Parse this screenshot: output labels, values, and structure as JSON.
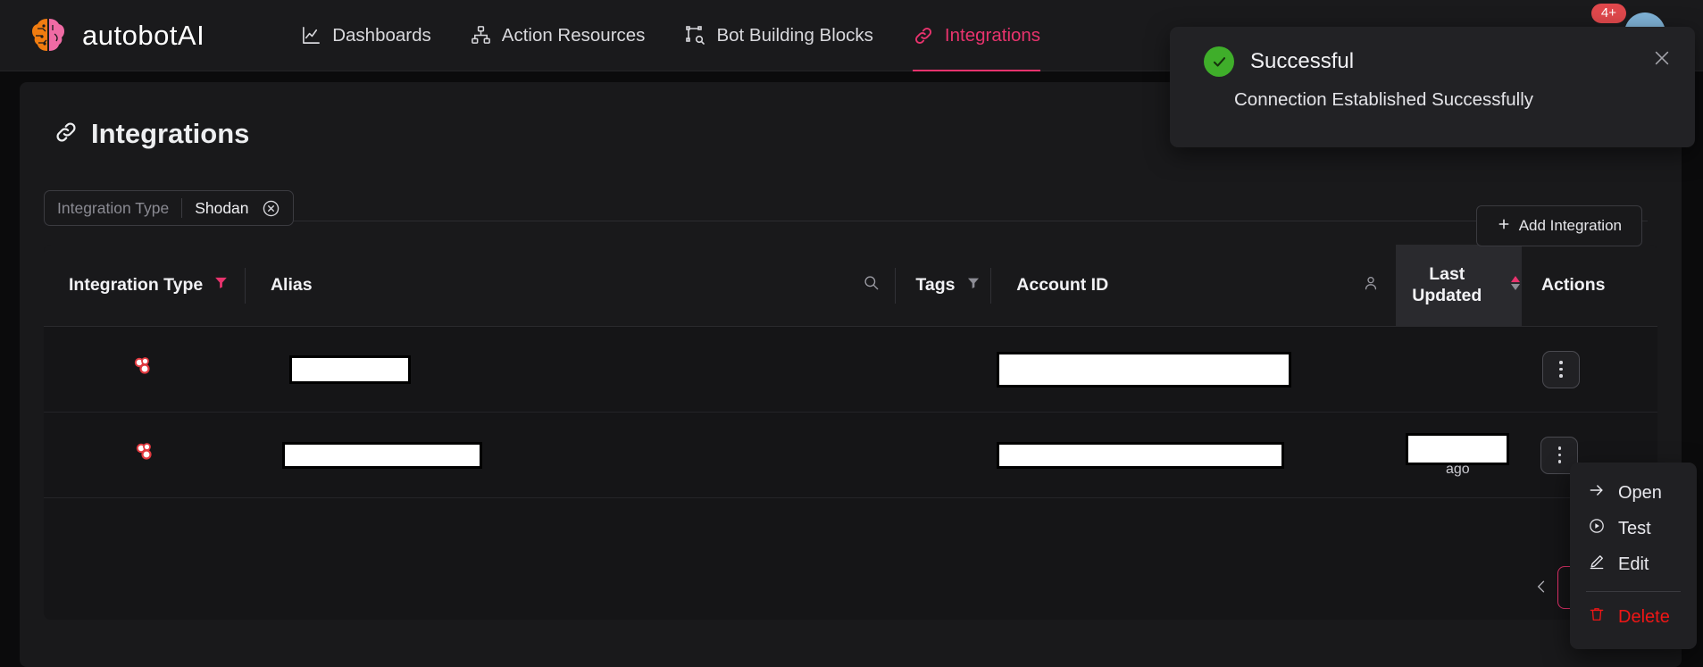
{
  "nav": {
    "brand": "autobotAI",
    "items": [
      {
        "label": "Dashboards",
        "icon": "chart-line-icon",
        "active": false
      },
      {
        "label": "Action Resources",
        "icon": "sitemap-icon",
        "active": false
      },
      {
        "label": "Bot Building Blocks",
        "icon": "blocks-icon",
        "active": false
      },
      {
        "label": "Integrations",
        "icon": "link-chain-icon",
        "active": true
      }
    ],
    "badge_count": "4+",
    "avatar": "user-avatar"
  },
  "page": {
    "title": "Integrations",
    "title_icon": "link-chain-icon",
    "add_button_label": "Add Integration"
  },
  "filter": {
    "label": "Integration Type",
    "value": "Shodan",
    "clear_icon": "circle-x-icon"
  },
  "table": {
    "columns": [
      {
        "key": "type",
        "label": "Integration Type",
        "icon": "filter-icon-active"
      },
      {
        "key": "alias",
        "label": "Alias",
        "icon": ""
      },
      {
        "key": "search",
        "label": "",
        "icon": "search-icon"
      },
      {
        "key": "tags",
        "label": "Tags",
        "icon": "filter-icon"
      },
      {
        "key": "account",
        "label": "Account ID",
        "icon": ""
      },
      {
        "key": "person",
        "label": "",
        "icon": "person-icon"
      },
      {
        "key": "last_updated",
        "label": "Last Updated",
        "icon": "sort-asc-desc-icon"
      },
      {
        "key": "actions",
        "label": "Actions",
        "icon": ""
      }
    ],
    "rows": [
      {
        "type_icon": "shodan-logo",
        "alias": "",
        "alias_redacted": true,
        "tags": "",
        "account": "",
        "account_redacted": true,
        "last_updated": "",
        "last_updated_redacted": false,
        "actions_icon": "kebab-menu-icon"
      },
      {
        "type_icon": "shodan-logo",
        "alias": "",
        "alias_redacted": true,
        "tags": "",
        "account": "",
        "account_redacted": true,
        "last_updated": "ago",
        "last_updated_redacted": true,
        "actions_icon": "kebab-menu-icon"
      }
    ],
    "pagination": {
      "prev_icon": "chevron-left-icon"
    }
  },
  "context_menu": {
    "items": [
      {
        "label": "Open",
        "icon": "arrow-right-icon",
        "danger": false
      },
      {
        "label": "Test",
        "icon": "play-circle-icon",
        "danger": false
      },
      {
        "label": "Edit",
        "icon": "pencil-icon",
        "danger": false
      },
      {
        "label": "Delete",
        "icon": "trash-icon",
        "danger": true
      }
    ]
  },
  "toast": {
    "title": "Successful",
    "message": "Connection Established Successfully",
    "status_icon": "check-circle-icon",
    "close_icon": "close-x-icon"
  },
  "colors": {
    "accent_pink": "#e8336d",
    "success_green": "#3fae2a",
    "danger_red": "#f01616",
    "badge_red": "#e0484c",
    "page_bg": "#0b0b0c",
    "panel_bg": "#19191b",
    "table_bg": "#151517"
  }
}
